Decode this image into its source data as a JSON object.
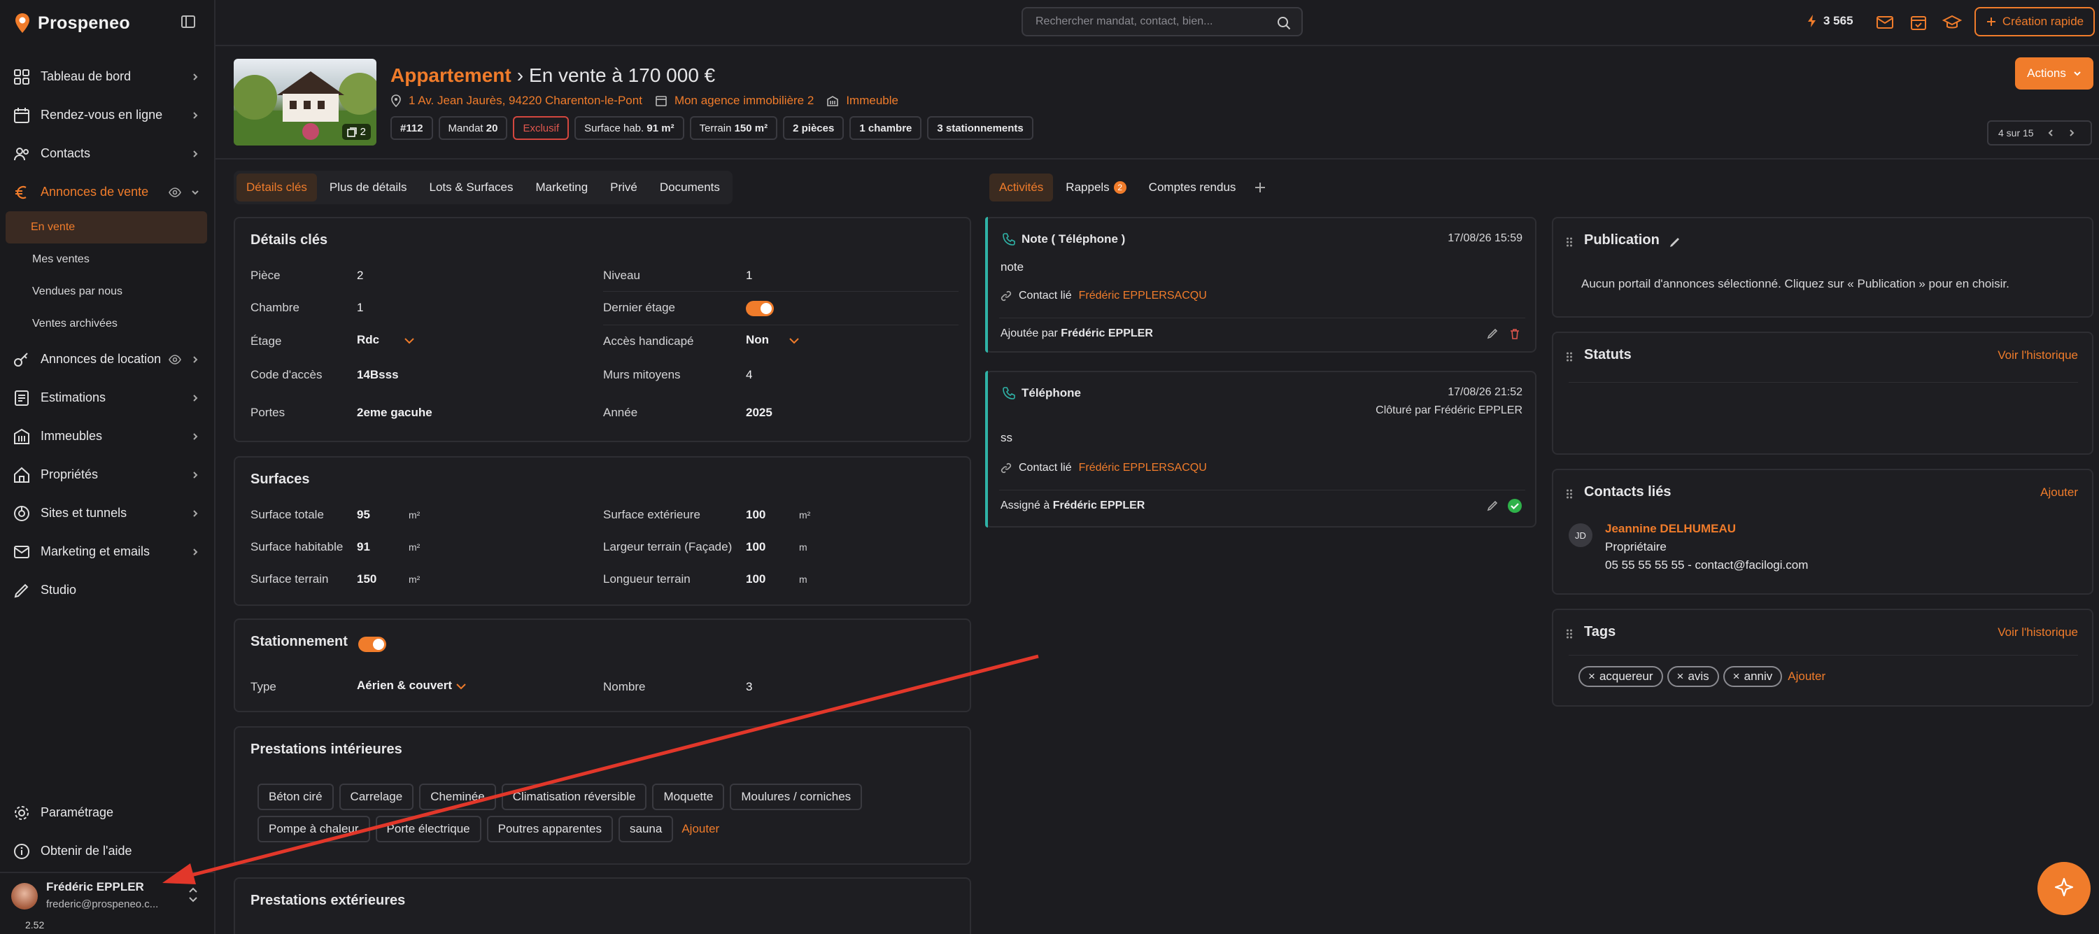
{
  "app": {
    "name": "Prospeneo",
    "version": "2.52"
  },
  "sidebar": {
    "items": [
      {
        "label": "Tableau de bord",
        "icon": "dashboard-icon"
      },
      {
        "label": "Rendez-vous en ligne",
        "icon": "calendar-icon"
      },
      {
        "label": "Contacts",
        "icon": "contacts-icon"
      },
      {
        "label": "Annonces de vente",
        "icon": "euro-icon"
      },
      {
        "label": "Annonces de location",
        "icon": "key-icon"
      },
      {
        "label": "Estimations",
        "icon": "document-icon"
      },
      {
        "label": "Immeubles",
        "icon": "building-icon"
      },
      {
        "label": "Propriétés",
        "icon": "house-icon"
      },
      {
        "label": "Sites et tunnels",
        "icon": "sites-icon"
      },
      {
        "label": "Marketing et emails",
        "icon": "mail-icon"
      },
      {
        "label": "Studio",
        "icon": "pen-icon"
      }
    ],
    "sub_items": [
      "En vente",
      "Mes ventes",
      "Vendues par nous",
      "Ventes archivées"
    ],
    "bottom": [
      {
        "label": "Paramétrage",
        "icon": "gear-icon"
      },
      {
        "label": "Obtenir de l'aide",
        "icon": "info-icon"
      }
    ],
    "user": {
      "name": "Frédéric EPPLER",
      "email": "frederic@prospeneo.c..."
    }
  },
  "topbar": {
    "search_placeholder": "Rechercher mandat, contact, bien...",
    "credits": "3 565",
    "quick_create": "Création rapide"
  },
  "listing": {
    "type": "Appartement",
    "status_price": "En vente à 170 000 €",
    "photo_count": "2",
    "address": "1 Av. Jean Jaurès, 94220 Charenton-le-Pont",
    "agency": "Mon agence immobilière 2",
    "building": "Immeuble",
    "chips": [
      {
        "label": "#112",
        "bold": true
      },
      {
        "label": "Mandat",
        "value": "20"
      },
      {
        "label": "Exclusif",
        "danger": true
      },
      {
        "label": "Surface hab.",
        "value": "91 m²"
      },
      {
        "label": "Terrain",
        "value": "150 m²"
      },
      {
        "label": "2 pièces",
        "bold": true
      },
      {
        "label": "1 chambre",
        "bold": true
      },
      {
        "label": "3 stationnements",
        "bold": true
      }
    ],
    "actions_label": "Actions",
    "pager": "4 sur 15"
  },
  "left_tabs": [
    "Détails clés",
    "Plus de détails",
    "Lots & Surfaces",
    "Marketing",
    "Privé",
    "Documents"
  ],
  "right_tabs": {
    "activities": "Activités",
    "reminders": "Rappels",
    "reminders_count": "2",
    "reports": "Comptes rendus"
  },
  "details": {
    "title": "Détails clés",
    "left": [
      {
        "label": "Pièce",
        "value": "2"
      },
      {
        "label": "Chambre",
        "value": "1"
      },
      {
        "label": "Étage",
        "value": "Rdc"
      },
      {
        "label": "Code d'accès",
        "value": "14Bsss"
      },
      {
        "label": "Portes",
        "value": "2eme gacuhe"
      }
    ],
    "right": [
      {
        "label": "Niveau",
        "value": "1"
      },
      {
        "label": "Dernier étage",
        "value": ""
      },
      {
        "label": "Accès handicapé",
        "value": "Non"
      },
      {
        "label": "Murs mitoyens",
        "value": "4"
      },
      {
        "label": "Année",
        "value": "2025"
      }
    ]
  },
  "surfaces": {
    "title": "Surfaces",
    "left": [
      {
        "label": "Surface totale",
        "value": "95",
        "unit": "m²"
      },
      {
        "label": "Surface habitable",
        "value": "91",
        "unit": "m²"
      },
      {
        "label": "Surface terrain",
        "value": "150",
        "unit": "m²"
      }
    ],
    "right": [
      {
        "label": "Surface extérieure",
        "value": "100",
        "unit": "m²"
      },
      {
        "label": "Largeur terrain (Façade)",
        "value": "100",
        "unit": "m"
      },
      {
        "label": "Longueur terrain",
        "value": "100",
        "unit": "m"
      }
    ]
  },
  "parking": {
    "title": "Stationnement",
    "type_label": "Type",
    "type_value": "Aérien & couvert",
    "count_label": "Nombre",
    "count_value": "3"
  },
  "interior": {
    "title": "Prestations intérieures",
    "tags": [
      "Béton ciré",
      "Carrelage",
      "Cheminée",
      "Climatisation réversible",
      "Moquette",
      "Moulures / corniches",
      "Pompe à chaleur",
      "Porte électrique",
      "Poutres apparentes",
      "sauna"
    ],
    "add_label": "Ajouter"
  },
  "exterior": {
    "title": "Prestations extérieures"
  },
  "activities": [
    {
      "title": "Note ( Téléphone )",
      "date": "17/08/26 15:59",
      "body": "note",
      "contact_label": "Contact lié",
      "contact": "Frédéric EPPLERSACQU",
      "footer_label": "Ajoutée par",
      "footer_user": "Frédéric EPPLER"
    },
    {
      "title": "Téléphone",
      "date": "17/08/26 21:52",
      "closed": "Clôturé par Frédéric EPPLER",
      "body": "ss",
      "contact_label": "Contact lié",
      "contact": "Frédéric EPPLERSACQU",
      "footer_label": "Assigné à",
      "footer_user": "Frédéric EPPLER"
    }
  ],
  "publication": {
    "title": "Publication",
    "text": "Aucun portail d'annonces sélectionné. Cliquez sur « Publication » pour en choisir."
  },
  "statuts": {
    "title": "Statuts",
    "link": "Voir l'historique"
  },
  "contacts": {
    "title": "Contacts liés",
    "add": "Ajouter",
    "initials": "JD",
    "name": "Jeannine DELHUMEAU",
    "role": "Propriétaire",
    "info": "05 55 55 55 55 - contact@facilogi.com"
  },
  "tags": {
    "title": "Tags",
    "link": "Voir l'historique",
    "items": [
      "acquereur",
      "avis",
      "anniv"
    ],
    "add": "Ajouter"
  },
  "colors": {
    "accent": "#f07c2b",
    "background": "#1c1c20",
    "teal": "#2fb2a6",
    "danger": "#e0574e",
    "success": "#2fb24a"
  }
}
